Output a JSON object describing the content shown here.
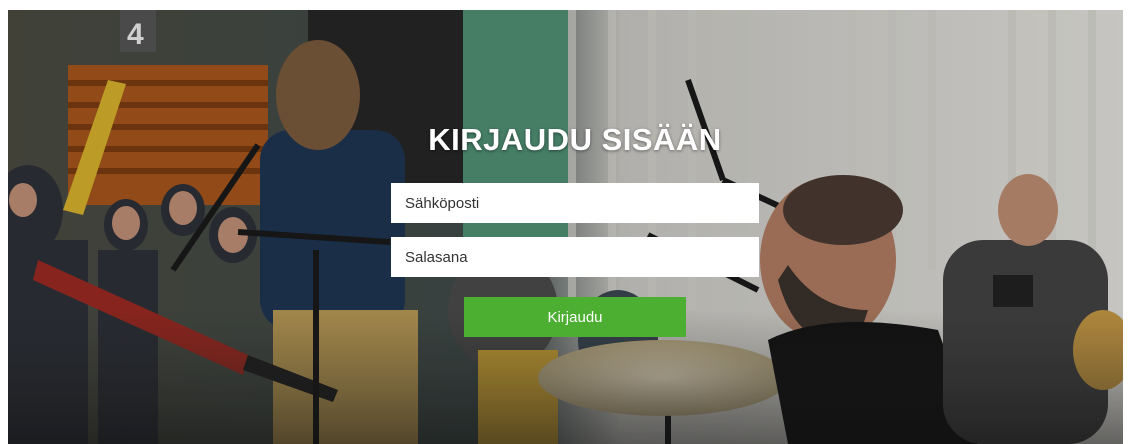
{
  "login": {
    "title": "KIRJAUDU SISÄÄN",
    "email_placeholder": "Sähköposti",
    "email_value": "",
    "password_placeholder": "Salasana",
    "password_value": "",
    "submit_label": "Kirjaudu"
  },
  "colors": {
    "button": "#4caf32",
    "title": "#ffffff",
    "field_background": "#ffffff"
  }
}
